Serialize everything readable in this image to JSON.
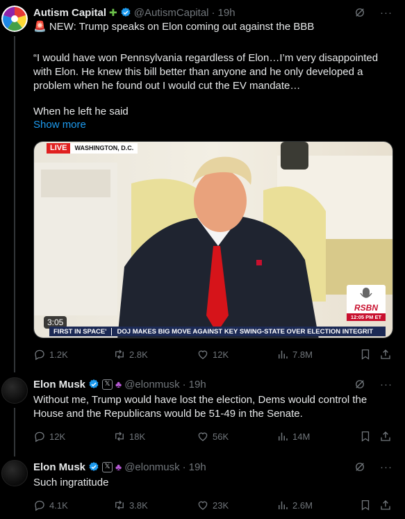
{
  "posts": [
    {
      "author": "Autism Capital",
      "handle": "@AutismCapital",
      "dot": "·",
      "time": "19h",
      "headline": "🚨 NEW: Trump speaks on Elon coming out against the BBB",
      "quote": "“I would have won Pennsylvania regardless of Elon…I’m very disappointed with Elon. He knew this bill better than anyone and he only developed a problem when he found out I would cut the EV mandate…",
      "quote2": "When he left he said",
      "show_more": "Show more",
      "video": {
        "live": "LIVE",
        "location": "WASHINGTON, D.C.",
        "duration": "3:05",
        "ticker_left": "FIRST IN SPACE'",
        "ticker_right": "DOJ MAKES BIG MOVE AGAINST KEY SWING-STATE OVER ELECTION INTEGRIT",
        "network": "RSBN",
        "network_time": "12:05 PM ET"
      },
      "stats": {
        "replies": "1.2K",
        "reposts": "2.8K",
        "likes": "12K",
        "views": "7.8M"
      }
    },
    {
      "author": "Elon Musk",
      "handle": "@elonmusk",
      "dot": "·",
      "time": "19h",
      "badge": "𝕏",
      "text": "Without me, Trump would have lost the election, Dems would control the House and the Republicans would be 51-49 in the Senate.",
      "stats": {
        "replies": "12K",
        "reposts": "18K",
        "likes": "56K",
        "views": "14M"
      }
    },
    {
      "author": "Elon Musk",
      "handle": "@elonmusk",
      "dot": "·",
      "time": "19h",
      "badge": "𝕏",
      "text": "Such ingratitude",
      "stats": {
        "replies": "4.1K",
        "reposts": "3.8K",
        "likes": "23K",
        "views": "2.6M"
      }
    }
  ],
  "more_label": "···",
  "colors": {
    "accent": "#1d9bf0",
    "muted": "#71767b",
    "background": "#000000",
    "text": "#e7e9ea"
  },
  "icons": [
    "reply-icon",
    "repost-icon",
    "like-icon",
    "views-icon",
    "bookmark-icon",
    "share-icon",
    "grok-icon",
    "more-icon",
    "verified-icon",
    "puzzle-icon",
    "people-icon"
  ]
}
